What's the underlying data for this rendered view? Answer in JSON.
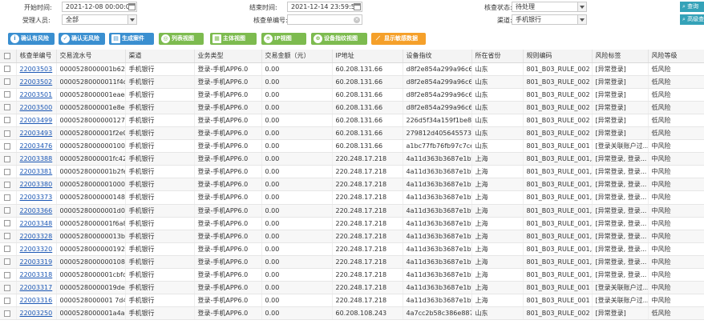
{
  "filters": {
    "start_time_label": "开始时间:",
    "start_time_value": "2021-12-08 00:00:00",
    "end_time_label": "结束时间:",
    "end_time_value": "2021-12-14 23:59:59",
    "status_label": "核查状态:",
    "status_value": "待处理",
    "person_label": "受理人员:",
    "person_value": "全部",
    "order_label": "核查单编号:",
    "order_value": "",
    "channel_label": "渠道:",
    "channel_value": "手机银行",
    "query_button": "查询",
    "high_query_button": "高级查询"
  },
  "toolbar": {
    "buttons": [
      {
        "label": "确认有风险",
        "icon": "info-icon"
      },
      {
        "label": "确认无风险",
        "icon": "check-icon"
      },
      {
        "label": "生成案件",
        "icon": "case-icon"
      },
      {
        "label": "列表视图",
        "icon": "list-icon"
      },
      {
        "label": "主体视图",
        "icon": "grid-icon"
      },
      {
        "label": "IP视图",
        "icon": "location-icon"
      },
      {
        "label": "设备指纹视图",
        "icon": "fingerprint-icon"
      },
      {
        "label": "显示敏感数据",
        "icon": "trend-icon"
      }
    ]
  },
  "table": {
    "headers": [
      "核查单编号",
      "交易流水号",
      "渠道",
      "业务类型",
      "交易金额（元）",
      "IP地址",
      "设备指纹",
      "所在省份",
      "规则编码",
      "风险标签",
      "风险等级"
    ],
    "rows": [
      [
        "22003503",
        "0000528000001b628...",
        "手机银行",
        "登录-手机APP6.0",
        "0.00",
        "60.208.131.66",
        "d8f2e854a299a96c68...",
        "山东",
        "801_B03_RULE_002",
        "[异常登录]",
        "低风险"
      ],
      [
        "22003502",
        "00005280000011f4d1...",
        "手机银行",
        "登录-手机APP6.0",
        "0.00",
        "60.208.131.66",
        "d8f2e854a299a96c68...",
        "山东",
        "801_B03_RULE_002",
        "[异常登录]",
        "低风险"
      ],
      [
        "22003501",
        "0000528000001eae4...",
        "手机银行",
        "登录-手机APP6.0",
        "0.00",
        "60.208.131.66",
        "d8f2e854a299a96c68...",
        "山东",
        "801_B03_RULE_002",
        "[异常登录]",
        "低风险"
      ],
      [
        "22003500",
        "0000528000001e8ed...",
        "手机银行",
        "登录-手机APP6.0",
        "0.00",
        "60.208.131.66",
        "d8f2e854a299a96c68...",
        "山东",
        "801_B03_RULE_002",
        "[异常登录]",
        "低风险"
      ],
      [
        "22003499",
        "00005280000001278d...",
        "手机银行",
        "登录-手机APP6.0",
        "0.00",
        "60.208.131.66",
        "226d5f34a159f1be8c...",
        "山东",
        "801_B03_RULE_002",
        "[异常登录]",
        "低风险"
      ],
      [
        "22003493",
        "0000528000001f2e02...",
        "手机银行",
        "登录-手机APP6.0",
        "0.00",
        "60.208.131.66",
        "279812d4056455736...",
        "山东",
        "801_B03_RULE_002",
        "[异常登录]",
        "低风险"
      ],
      [
        "22003476",
        "0000528000000100de...",
        "手机银行",
        "登录-手机APP6.0",
        "0.00",
        "60.208.131.66",
        "a1bc77fb76fb97c7ce4...",
        "山东",
        "801_B03_RULE_001",
        "[登录关联账户过...",
        "中风险"
      ],
      [
        "22003388",
        "0000528000001fc423...",
        "手机银行",
        "登录-手机APP6.0",
        "0.00",
        "220.248.17.218",
        "4a11d363b3687e1bf4...",
        "上海",
        "801_B03_RULE_001,...",
        "[异常登录, 登录...",
        "中风险"
      ],
      [
        "22003381",
        "0000528000001b2fee...",
        "手机银行",
        "登录-手机APP6.0",
        "0.00",
        "220.248.17.218",
        "4a11d363b3687e1bf4...",
        "上海",
        "801_B03_RULE_001,...",
        "[异常登录, 登录...",
        "中风险"
      ],
      [
        "22003380",
        "0000528000001000e6...",
        "手机银行",
        "登录-手机APP6.0",
        "0.00",
        "220.248.17.218",
        "4a11d363b3687e1bf4...",
        "上海",
        "801_B03_RULE_001,...",
        "[异常登录, 登录...",
        "中风险"
      ],
      [
        "22003373",
        "00005280000001484f8...",
        "手机银行",
        "登录-手机APP6.0",
        "0.00",
        "220.248.17.218",
        "4a11d363b3687e1bf4...",
        "上海",
        "801_B03_RULE_001,...",
        "[异常登录, 登录...",
        "中风险"
      ],
      [
        "22003366",
        "00005280000001d018...",
        "手机银行",
        "登录-手机APP6.0",
        "0.00",
        "220.248.17.218",
        "4a11d363b3687e1bf4...",
        "上海",
        "801_B03_RULE_001,...",
        "[异常登录, 登录...",
        "中风险"
      ],
      [
        "22003348",
        "0000528000001f6a84...",
        "手机银行",
        "登录-手机APP6.0",
        "0.00",
        "220.248.17.218",
        "4a11d363b3687e1bf4...",
        "上海",
        "801_B03_RULE_001,...",
        "[异常登录, 登录...",
        "中风险"
      ],
      [
        "22003328",
        "000052800000013b4fe...",
        "手机银行",
        "登录-手机APP6.0",
        "0.00",
        "220.248.17.218",
        "4a11d363b3687e1bf4...",
        "上海",
        "801_B03_RULE_001,...",
        "[异常登录, 登录...",
        "中风险"
      ],
      [
        "22003320",
        "0000528000000192fff4...",
        "手机银行",
        "登录-手机APP6.0",
        "0.00",
        "220.248.17.218",
        "4a11d363b3687e1bf4...",
        "上海",
        "801_B03_RULE_001,...",
        "[异常登录, 登录...",
        "中风险"
      ],
      [
        "22003319",
        "0000528000000108c4...",
        "手机银行",
        "登录-手机APP6.0",
        "0.00",
        "220.248.17.218",
        "4a11d363b3687e1bf4...",
        "上海",
        "801_B03_RULE_001,...",
        "[异常登录, 登录...",
        "中风险"
      ],
      [
        "22003318",
        "0000528000001cbfdc...",
        "手机银行",
        "登录-手机APP6.0",
        "0.00",
        "220.248.17.218",
        "4a11d363b3687e1bf4...",
        "上海",
        "801_B03_RULE_001,...",
        "[异常登录, 登录...",
        "中风险"
      ],
      [
        "22003317",
        "00005280000019dec...",
        "手机银行",
        "登录-手机APP6.0",
        "0.00",
        "220.248.17.218",
        "4a11d363b3687e1bf4...",
        "上海",
        "801_B03_RULE_001",
        "[登录关联账户过...",
        "中风险"
      ],
      [
        "22003316",
        "0000528000001 7d47...",
        "手机银行",
        "登录-手机APP6.0",
        "0.00",
        "220.248.17.218",
        "4a11d363b3687e1bf4...",
        "上海",
        "801_B03_RULE_001",
        "[登录关联账户过...",
        "中风险"
      ],
      [
        "22003250",
        "0000528000001a4aa...",
        "手机银行",
        "登录-手机APP6.0",
        "0.00",
        "60.208.108.243",
        "4a7cc2b58c386e8879...",
        "山东",
        "801_B03_RULE_002",
        "[异常登录]",
        "低风险"
      ]
    ]
  },
  "colors": {
    "blue_button": "#3a8fd0",
    "green_button": "#7dbb4f",
    "orange_button": "#f5a02a",
    "side_button": "#34a2b8",
    "link": "#1a56b4"
  }
}
